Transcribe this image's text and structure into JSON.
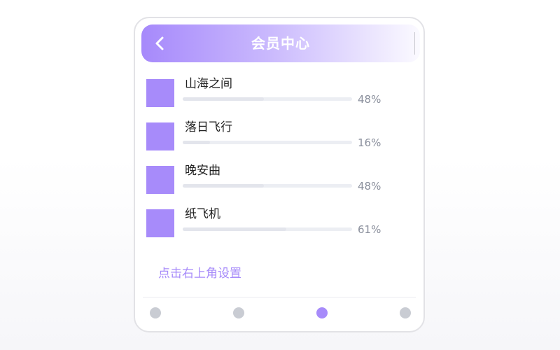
{
  "header": {
    "title": "会员中心",
    "back_icon": "chevron-left-icon"
  },
  "members": [
    {
      "name": "山海之间",
      "percent_label": "48%",
      "progress": 0.48
    },
    {
      "name": "落日飞行",
      "percent_label": "16%",
      "progress": 0.16
    },
    {
      "name": "晚安曲",
      "percent_label": "48%",
      "progress": 0.48
    },
    {
      "name": "纸飞机",
      "percent_label": "61%",
      "progress": 0.61
    }
  ],
  "hint_text": "点击右上角设置",
  "pagination": {
    "count": 4,
    "active_index": 2
  },
  "colors": {
    "accent": "#a78bfa",
    "inactive_dot": "#c9ccd3",
    "track": "#eceef3"
  }
}
